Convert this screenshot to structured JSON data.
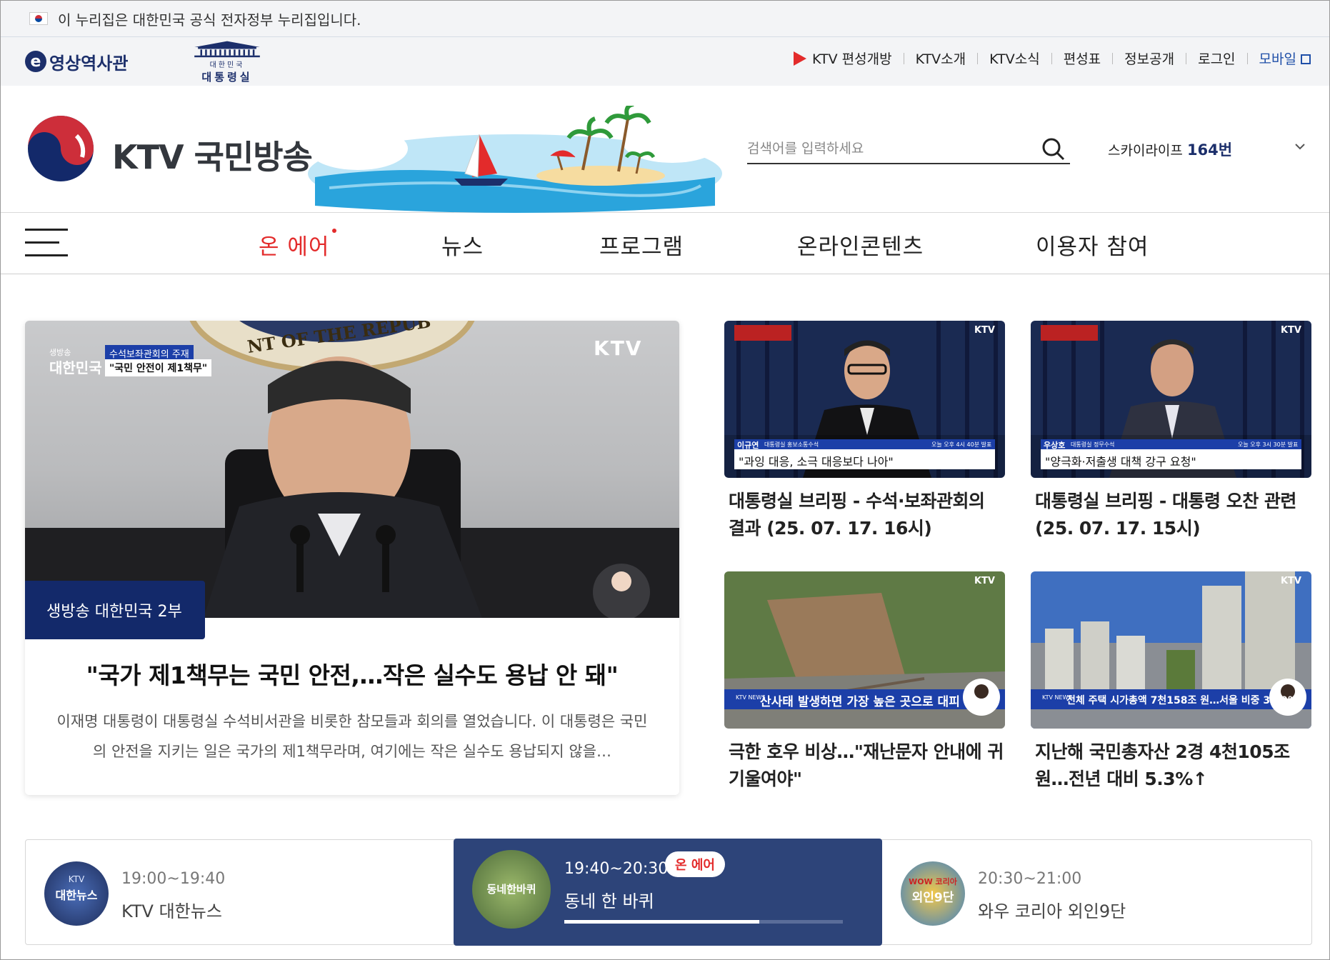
{
  "gov_bar": {
    "notice": "이 누리집은 대한민국 공식 전자정부 누리집입니다."
  },
  "util": {
    "elogo_text": "영상역사관",
    "pres_sub": "대한민국",
    "pres_name": "대통령실",
    "links": [
      "KTV 편성개방",
      "KTV소개",
      "KTV소식",
      "편성표",
      "정보공개",
      "로그인"
    ],
    "mobile": "모바일"
  },
  "header": {
    "brand": "KTV 국민방송",
    "search_placeholder": "검색어를 입력하세요",
    "skylife_label": "스카이라이프",
    "skylife_channel": "164번"
  },
  "nav": {
    "items": [
      "온 에어",
      "뉴스",
      "프로그램",
      "온라인콘텐츠",
      "이용자 참여"
    ]
  },
  "feature": {
    "caption_small": "생방송",
    "caption_big": "대한민국",
    "caption_line1": "수석보좌관회의 주재",
    "caption_line2": "\"국민 안전이 제1책무\"",
    "watermark": "KTV",
    "seal_text": "NT OF THE REPUB",
    "badge": "생방송 대한민국 2부",
    "title": "\"국가 제1책무는 국민 안전,…작은 실수도 용납 안 돼\"",
    "desc": "이재명 대통령이 대통령실 수석비서관을 비롯한 참모들과 회의를 열었습니다. 이 대통령은 국민의 안전을 지키는 일은 국가의 제1책무라며, 여기에는 작은 실수도 용납되지 않을…"
  },
  "cards": [
    {
      "title": "대통령실 브리핑 - 수석·보좌관회의 결과 (25. 07. 17. 16시)",
      "person": "이규연",
      "role": "대통령실 홍보소통수석",
      "caption": "\"과잉 대응, 소극 대응보다 나아\"",
      "time": "오늘 오후 4시 40분 발표",
      "watermark": "KTV"
    },
    {
      "title": "대통령실 브리핑 - 대통령 오찬 관련 (25. 07. 17. 15시)",
      "person": "우상호",
      "role": "대통령실 정무수석",
      "caption": "\"양극화·저출생 대책 강구 요청\"",
      "time": "오늘 오후 3시 30분 발표",
      "watermark": "KTV"
    },
    {
      "title": "극한 호우 비상…\"재난문자 안내에 귀 기울여야\"",
      "caption": "산사태 발생하면 가장 높은 곳으로 대피",
      "tag": "KTV NEWS",
      "watermark": "KTV"
    },
    {
      "title": "지난해 국민총자산 2경 4천105조 원…전년 대비 5.3%↑",
      "caption": "전체 주택 시가총액 7천158조 원…서울 비중 34.9%",
      "tag": "KTV NEWS",
      "watermark": "KTV"
    }
  ],
  "schedule": [
    {
      "time": "19:00~19:40",
      "name": "KTV 대한뉴스",
      "logo_top": "KTV",
      "logo": "대한뉴스"
    },
    {
      "time": "19:40~20:30",
      "name": "동네 한 바퀴",
      "logo": "동네한바퀴",
      "badge": "온 에어",
      "progress": 0.7
    },
    {
      "time": "20:30~21:00",
      "name": "와우 코리아 외인9단",
      "logo_top": "WOW 코리아",
      "logo": "외인9단"
    }
  ],
  "colors": {
    "navy": "#13296a",
    "accent_red": "#e32b2b",
    "schedule_active": "#2d4479"
  }
}
